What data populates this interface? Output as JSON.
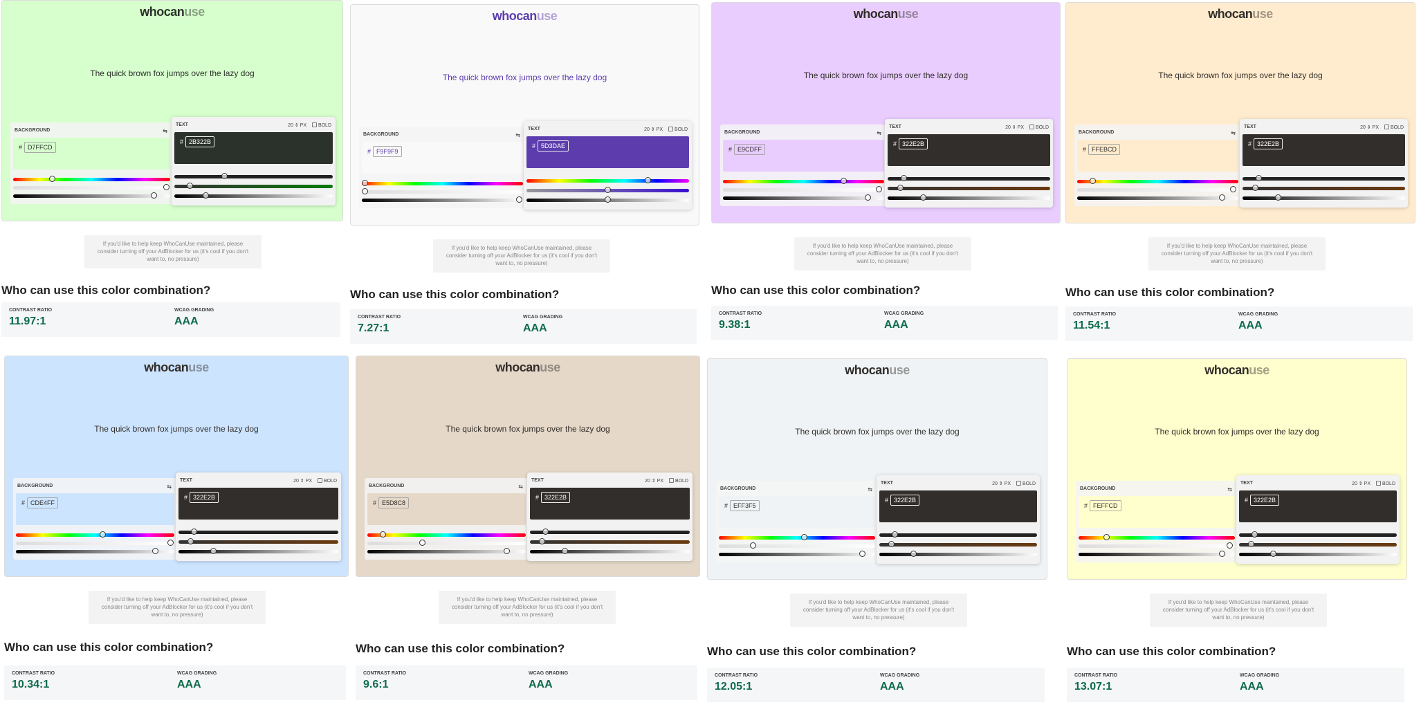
{
  "logo": {
    "who": "who",
    "can": "can",
    "use": "use"
  },
  "pangram": "The quick brown fox jumps over the lazy dog",
  "labels": {
    "background": "BACKGROUND",
    "text": "TEXT",
    "px": "PX",
    "bold": "BOLD",
    "hash": "#",
    "contrast_ratio": "CONTRAST RATIO",
    "wcag_grading": "WCAG GRADING"
  },
  "heading": "Who can use this color combination?",
  "ad_text": "If you'd like to help keep WhoCanUse maintained, please consider turning off your AdBlocker for us (it's cool if you don't want to, no pressure)",
  "icons": {
    "swap": "swap-icon",
    "stepper": "stepper-icon",
    "checkbox": "checkbox-icon"
  },
  "panels": [
    {
      "bg_hex": "D7FFCD",
      "bg_color": "#D7FFCD",
      "text_hex": "2B322B",
      "text_color": "#2B322B",
      "font_size": "20",
      "contrast": "11.97:1",
      "wcag": "AAA"
    },
    {
      "bg_hex": "F9F9F9",
      "bg_color": "#F9F9F9",
      "text_hex": "5D3DAE",
      "text_color": "#5D3DAE",
      "font_size": "20",
      "contrast": "7.27:1",
      "wcag": "AAA"
    },
    {
      "bg_hex": "E9CDFF",
      "bg_color": "#E9CDFF",
      "text_hex": "322E2B",
      "text_color": "#322E2B",
      "font_size": "20",
      "contrast": "9.38:1",
      "wcag": "AAA"
    },
    {
      "bg_hex": "FFEBCD",
      "bg_color": "#FFEBCD",
      "text_hex": "322E2B",
      "text_color": "#322E2B",
      "font_size": "20",
      "contrast": "11.54:1",
      "wcag": "AAA"
    },
    {
      "bg_hex": "CDE4FF",
      "bg_color": "#CDE4FF",
      "text_hex": "322E2B",
      "text_color": "#322E2B",
      "font_size": "20",
      "contrast": "10.34:1",
      "wcag": "AAA"
    },
    {
      "bg_hex": "E5D8C8",
      "bg_color": "#E5D8C8",
      "text_hex": "322E2B",
      "text_color": "#322E2B",
      "font_size": "20",
      "contrast": "9.6:1",
      "wcag": "AAA"
    },
    {
      "bg_hex": "EFF3F5",
      "bg_color": "#EFF3F5",
      "text_hex": "322E2B",
      "text_color": "#322E2B",
      "font_size": "20",
      "contrast": "12.05:1",
      "wcag": "AAA"
    },
    {
      "bg_hex": "FEFFCD",
      "bg_color": "#FEFFCD",
      "text_hex": "322E2B",
      "text_color": "#322E2B",
      "font_size": "20",
      "contrast": "13.07:1",
      "wcag": "AAA"
    }
  ]
}
